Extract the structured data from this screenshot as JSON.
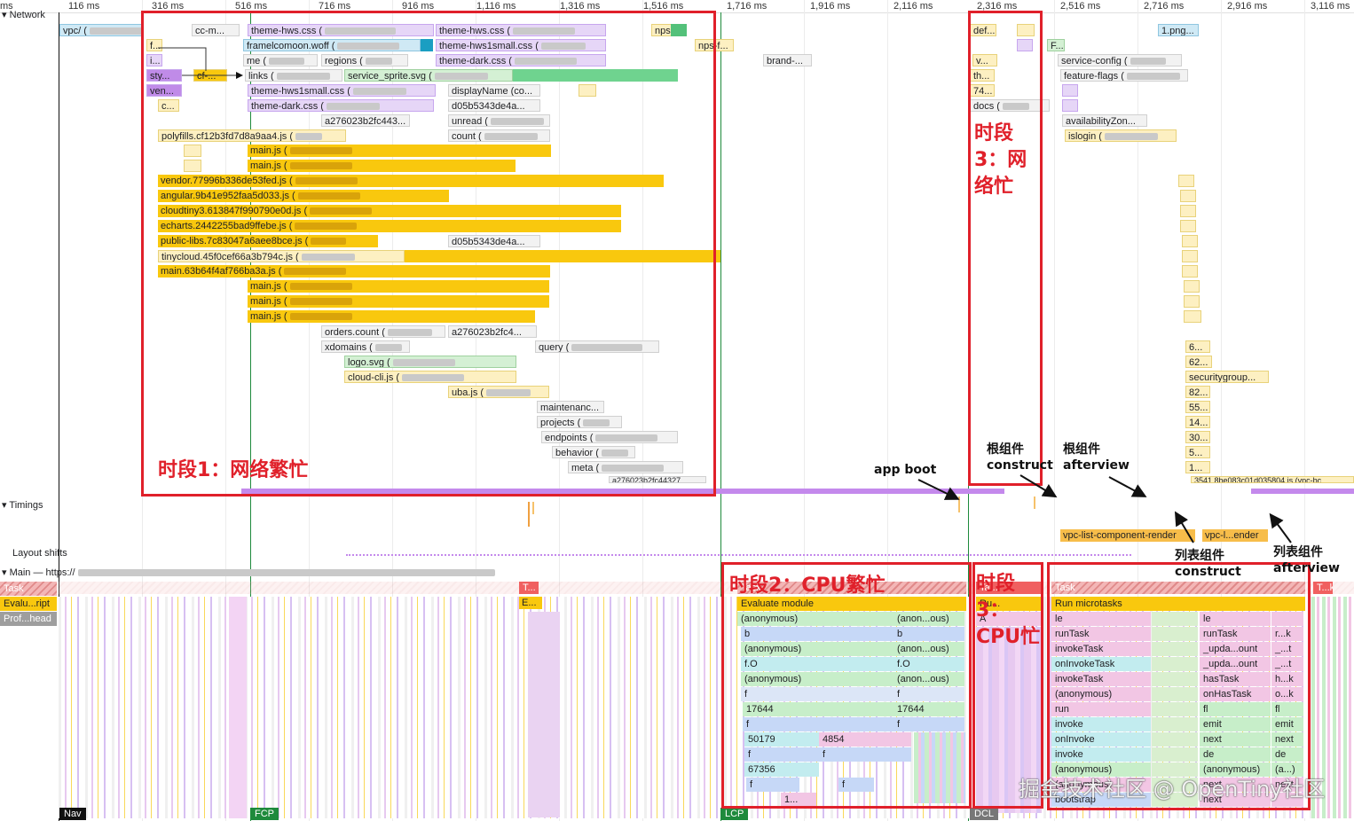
{
  "ruler": {
    "ticks": [
      "ms",
      "116 ms",
      "316 ms",
      "516 ms",
      "716 ms",
      "916 ms",
      "1,116 ms",
      "1,316 ms",
      "1,516 ms",
      "1,716 ms",
      "1,916 ms",
      "2,116 ms",
      "2,316 ms",
      "2,516 ms",
      "2,716 ms",
      "2,916 ms",
      "3,116 ms"
    ]
  },
  "tracks": {
    "network": "Network",
    "timings": "Timings",
    "layout_shifts": "Layout shifts",
    "main": "Main — https://",
    "task": "Task",
    "evaluate": "Evalu...ript",
    "profile": "Prof...head"
  },
  "network": {
    "rows": [
      {
        "label": "vpc/ (",
        "kind": "font"
      },
      {
        "label": "cc-m...",
        "kind": "xhr"
      },
      {
        "label": "theme-hws.css (",
        "kind": "css"
      },
      {
        "label": "theme-hws.css (",
        "kind": "css"
      },
      {
        "label": "nps...",
        "kind": "js"
      },
      {
        "label": "f...",
        "kind": "js"
      },
      {
        "label": "framelcomoon.woff (",
        "kind": "font"
      },
      {
        "label": "theme-hws1small.css (",
        "kind": "css"
      },
      {
        "label": "nps-f...",
        "kind": "js"
      },
      {
        "label": "brand-...",
        "kind": "xhr"
      },
      {
        "label": "i...",
        "kind": "css"
      },
      {
        "label": "me (",
        "kind": "xhr"
      },
      {
        "label": "regions (",
        "kind": "xhr"
      },
      {
        "label": "theme-dark.css (",
        "kind": "css"
      },
      {
        "label": "sty...",
        "kind": "css"
      },
      {
        "label": "cf-...",
        "kind": "js"
      },
      {
        "label": "links (",
        "kind": "xhr"
      },
      {
        "label": "service_sprite.svg (",
        "kind": "img"
      },
      {
        "label": "ven...",
        "kind": "css"
      },
      {
        "label": "theme-hws1small.css (",
        "kind": "css"
      },
      {
        "label": "displayName (co...",
        "kind": "xhr"
      },
      {
        "label": "c...",
        "kind": "js"
      },
      {
        "label": "theme-dark.css (",
        "kind": "css"
      },
      {
        "label": "d05b5343de4a...",
        "kind": "xhr"
      },
      {
        "label": "a276023b2fc443...",
        "kind": "xhr"
      },
      {
        "label": "unread (",
        "kind": "xhr"
      },
      {
        "label": "polyfills.cf12b3fd7d8a9aa4.js (",
        "kind": "js"
      },
      {
        "label": "count (",
        "kind": "xhr"
      },
      {
        "label": "main.js (",
        "kind": "js"
      },
      {
        "label": "main.js (",
        "kind": "js"
      },
      {
        "label": "vendor.77996b336de53fed.js (",
        "kind": "js"
      },
      {
        "label": "angular.9b41e952faa5d033.js (",
        "kind": "js"
      },
      {
        "label": "cloudtiny3.613847f990790e0d.js (",
        "kind": "js"
      },
      {
        "label": "echarts.2442255bad9ffebe.js (",
        "kind": "js"
      },
      {
        "label": "public-libs.7c83047a6aee8bce.js (",
        "kind": "js"
      },
      {
        "label": "d05b5343de4a...",
        "kind": "xhr"
      },
      {
        "label": "tinycloud.45f0cef66a3b794c.js (",
        "kind": "js"
      },
      {
        "label": "main.63b64f4af766ba3a.js (",
        "kind": "js"
      },
      {
        "label": "main.js (",
        "kind": "js"
      },
      {
        "label": "main.js (",
        "kind": "js"
      },
      {
        "label": "main.js (",
        "kind": "js"
      },
      {
        "label": "orders.count (",
        "kind": "xhr"
      },
      {
        "label": "a276023b2fc4...",
        "kind": "xhr"
      },
      {
        "label": "xdomains (",
        "kind": "xhr"
      },
      {
        "label": "query (",
        "kind": "xhr"
      },
      {
        "label": "logo.svg (",
        "kind": "img"
      },
      {
        "label": "cloud-cli.js (",
        "kind": "js"
      },
      {
        "label": "uba.js (",
        "kind": "js"
      },
      {
        "label": "maintenanc...",
        "kind": "xhr"
      },
      {
        "label": "projects (",
        "kind": "xhr"
      },
      {
        "label": "endpoints (",
        "kind": "xhr"
      },
      {
        "label": "behavior (",
        "kind": "xhr"
      },
      {
        "label": "meta (",
        "kind": "xhr"
      },
      {
        "label": "a276023b2fc44327...",
        "kind": "xhr"
      },
      {
        "label": "def...",
        "kind": "js"
      },
      {
        "label": "1.png...",
        "kind": "img"
      },
      {
        "label": "F...",
        "kind": "img"
      },
      {
        "label": "v...",
        "kind": "js"
      },
      {
        "label": "service-config (",
        "kind": "xhr"
      },
      {
        "label": "th...",
        "kind": "js"
      },
      {
        "label": "feature-flags (",
        "kind": "xhr"
      },
      {
        "label": "74...",
        "kind": "js"
      },
      {
        "label": "docs (",
        "kind": "xhr"
      },
      {
        "label": "availabilityZon...",
        "kind": "xhr"
      },
      {
        "label": "islogin (",
        "kind": "js"
      },
      {
        "label": "6...",
        "kind": "js"
      },
      {
        "label": "62...",
        "kind": "js"
      },
      {
        "label": "securitygroup...",
        "kind": "js"
      },
      {
        "label": "82...",
        "kind": "js"
      },
      {
        "label": "55...",
        "kind": "js"
      },
      {
        "label": "14...",
        "kind": "js"
      },
      {
        "label": "30...",
        "kind": "js"
      },
      {
        "label": "5...",
        "kind": "js"
      },
      {
        "label": "1...",
        "kind": "js"
      },
      {
        "label": "3541.8be083c01d035804.js (vpc-bc",
        "kind": "js"
      }
    ]
  },
  "timings": {
    "list_render": "vpc-list-component-render",
    "list_render2": "vpc-l...ender"
  },
  "flame": {
    "phase2_top": "Task",
    "phase2_eval": "Evaluate module",
    "phase2_rows": [
      [
        "(anonymous)",
        "(anon...ous)"
      ],
      [
        "b",
        "b"
      ],
      [
        "(anonymous)",
        "(anon...ous)"
      ],
      [
        "f.O",
        "f.O"
      ],
      [
        "(anonymous)",
        "(anon...ous)"
      ],
      [
        "f",
        "f"
      ],
      [
        "17644",
        "17644"
      ],
      [
        "f",
        "f"
      ],
      [
        "50179",
        "4854"
      ],
      [
        "f",
        "f"
      ],
      [
        "67356",
        ""
      ],
      [
        "f",
        "f"
      ],
      [
        "1...",
        ""
      ]
    ],
    "phase3_top": "Task",
    "phase3_eval": "Run microtasks",
    "phase3_left": [
      "le",
      "runTask",
      "invokeTask",
      "onInvokeTask",
      "invokeTask",
      "(anonymous)",
      "run",
      "invoke",
      "onInvoke",
      "invoke",
      "(anonymous)",
      "(anonymous)",
      "bootstrap"
    ],
    "phase3_mid": [
      "le",
      "runTask",
      "_upda...ount",
      "_upda...ount",
      "hasTask",
      "onHasTask",
      "fl",
      "emit",
      "next",
      "de",
      "(anonymous)",
      "next",
      "next"
    ],
    "phase3_right": [
      "",
      "r...k",
      "_...t",
      "_...t",
      "h...k",
      "o...k",
      "fl",
      "emit",
      "next",
      "de",
      "(a...)",
      "next",
      ""
    ],
    "misc": [
      "T...",
      "E...",
      "T...k",
      "Ta...",
      "Ru...",
      "A"
    ]
  },
  "markers": {
    "nav": "Nav",
    "fcp": "FCP",
    "lcp": "LCP",
    "dcl": "DCL"
  },
  "annotations": {
    "phase1": "时段1：网络繁忙",
    "phase2": "时段2：CPU繁忙",
    "phase3_net": "时段3：网络忙",
    "phase3_cpu": "时段3：CPU忙",
    "app_boot": "app boot",
    "root_construct": "根组件 construct",
    "root_afterview": "根组件 afterview",
    "list_construct": "列表组件 construct",
    "list_afterview": "列表组件 afterview"
  },
  "watermark": "掘金技术社区 @ OpenTiny社区",
  "colors": {
    "annotation_red": "#e0202a",
    "js_yellow": "#f9c80e",
    "css_purple": "#e6d6f7",
    "xhr_gray": "#f2f2f2",
    "img_green": "#d4f0d4",
    "font_blue": "#cfe9f5",
    "fcp_green": "#1e8a3c"
  }
}
